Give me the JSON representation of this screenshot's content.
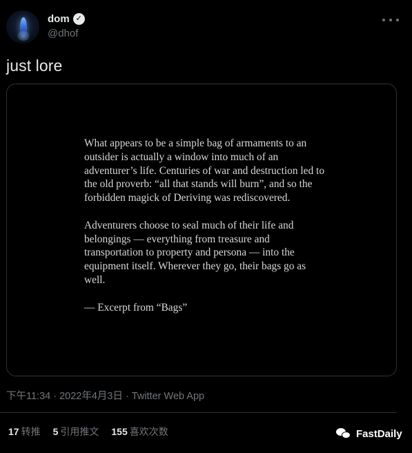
{
  "author": {
    "display_name": "dom",
    "handle": "@dhof",
    "verified_icon": "verified-badge-icon"
  },
  "tweet": {
    "text": "just lore"
  },
  "media": {
    "paragraphs": [
      "What appears to be a simple bag of armaments to an outsider is actually a window into much of an adventurer’s life. Centuries of war and destruction led to the old proverb: “all that stands will burn”, and so the forbidden magick of Deriving was rediscovered.",
      "Adventurers choose to seal much of their life and belongings — everything from treasure and transportation to property and persona — into the equipment itself. Wherever they go, their bags go as well.",
      "— Excerpt from “Bags”"
    ]
  },
  "meta": {
    "time": "下午11:34",
    "date": "2022年4月3日",
    "separator": "·",
    "source": "Twitter Web App"
  },
  "stats": {
    "retweets": {
      "count": "17",
      "label": "转推"
    },
    "quotes": {
      "count": "5",
      "label": "引用推文"
    },
    "likes": {
      "count": "155",
      "label": "喜欢次数"
    }
  },
  "watermark": {
    "text": "FastDaily",
    "icon": "wechat-icon"
  },
  "colors": {
    "background": "#000000",
    "primary_text": "#e7e9ea",
    "secondary_text": "#71767b",
    "border": "#2f3336"
  }
}
